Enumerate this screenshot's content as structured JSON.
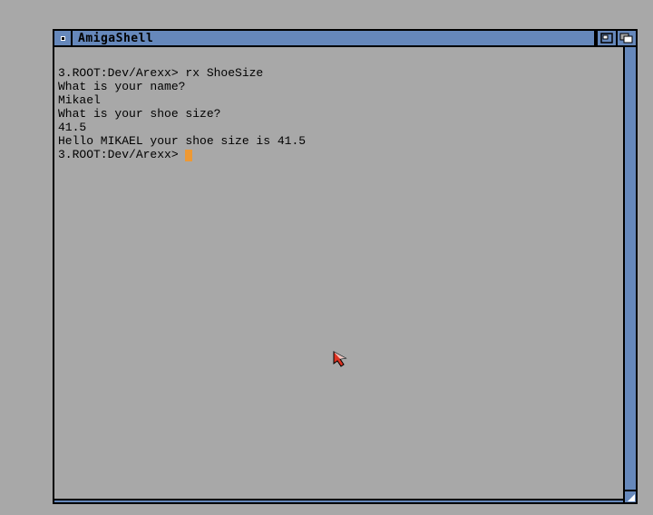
{
  "window": {
    "title": "AmigaShell"
  },
  "terminal": {
    "prompt": "3.ROOT:Dev/Arexx> ",
    "lines": [
      "3.ROOT:Dev/Arexx> rx ShoeSize",
      "What is your name?",
      "Mikael",
      "What is your shoe size?",
      "41.5",
      "Hello MIKAEL your shoe size is 41.5",
      "3.ROOT:Dev/Arexx> "
    ]
  },
  "chart_data": null
}
